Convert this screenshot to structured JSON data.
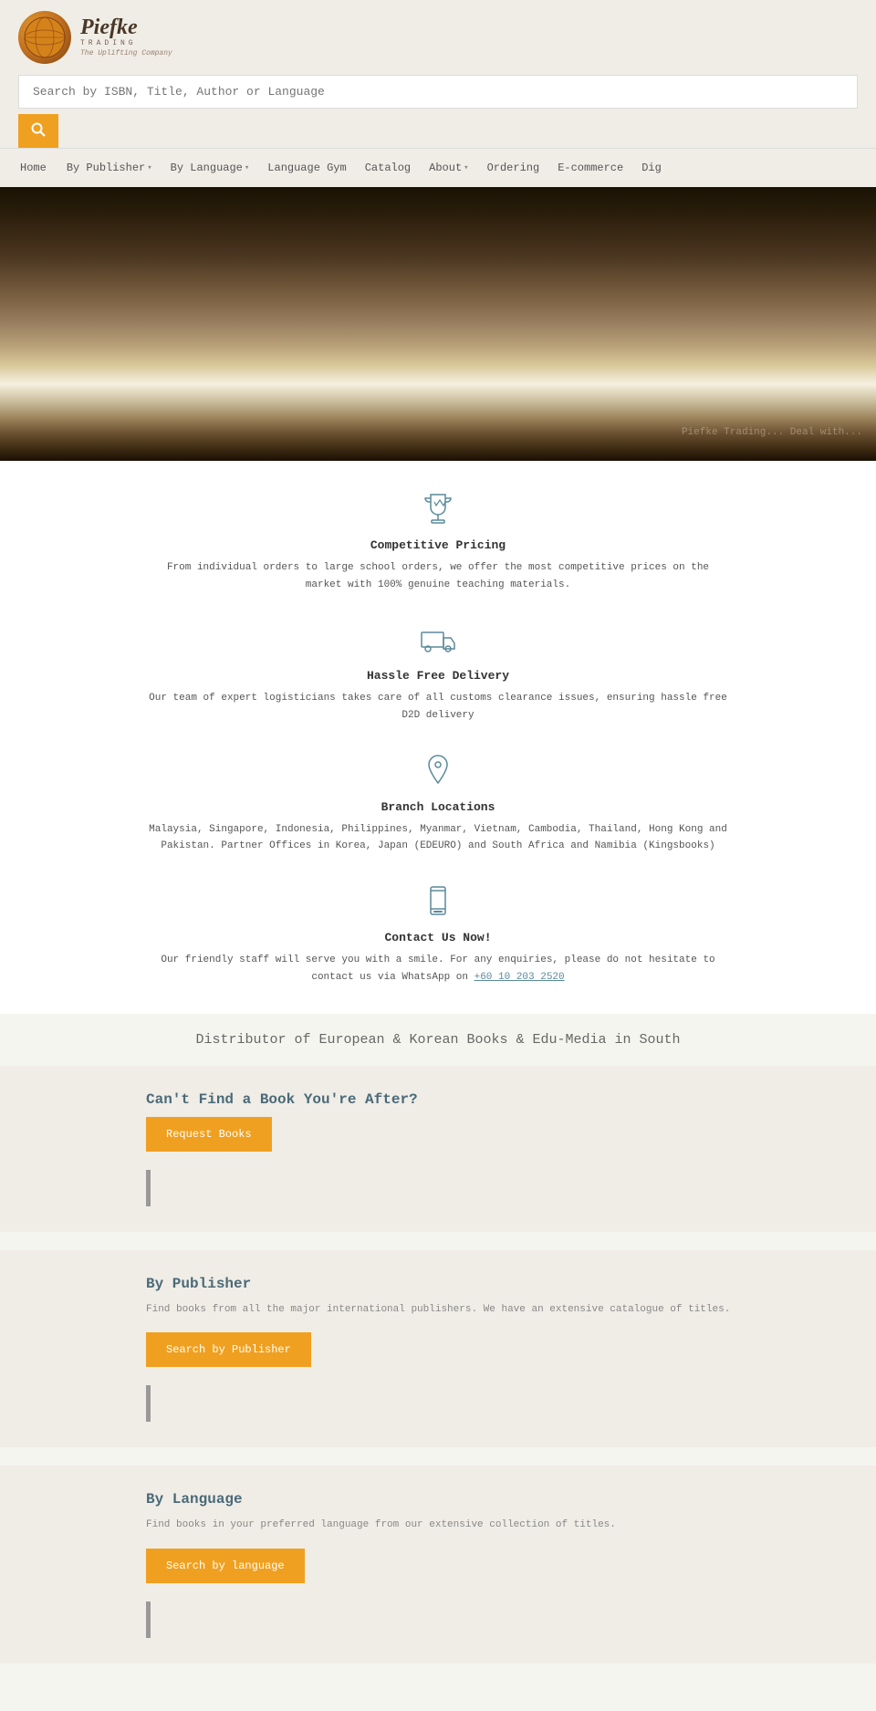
{
  "header": {
    "logo_emoji": "🌐",
    "logo_name": "Piefke",
    "logo_trading": "TRADING",
    "logo_tagline": "The Uplifting Company"
  },
  "search": {
    "placeholder": "Search by ISBN, Title, Author or Language",
    "button_label": "🔍"
  },
  "nav": {
    "items": [
      {
        "label": "Home",
        "has_dropdown": false
      },
      {
        "label": "By Publisher",
        "has_dropdown": true
      },
      {
        "label": "By Language",
        "has_dropdown": true
      },
      {
        "label": "Language Gym",
        "has_dropdown": false
      },
      {
        "label": "Catalog",
        "has_dropdown": false
      },
      {
        "label": "About",
        "has_dropdown": true
      },
      {
        "label": "Ordering",
        "has_dropdown": false
      },
      {
        "label": "E-commerce",
        "has_dropdown": false
      },
      {
        "label": "Dig",
        "has_dropdown": false
      }
    ]
  },
  "hero": {
    "watermark": "Piefke Trading... Deal with..."
  },
  "features": [
    {
      "id": "competitive-pricing",
      "icon": "trophy",
      "title": "Competitive Pricing",
      "desc": "From individual orders to large school orders, we offer the most competitive prices on the market with 100% genuine teaching materials."
    },
    {
      "id": "hassle-free-delivery",
      "icon": "truck",
      "title": "Hassle Free Delivery",
      "desc": "Our team of expert logisticians takes care of all customs clearance issues, ensuring hassle free D2D delivery"
    },
    {
      "id": "branch-locations",
      "icon": "location",
      "title": "Branch Locations",
      "desc": "Malaysia, Singapore, Indonesia, Philippines, Myanmar, Vietnam, Cambodia, Thailand,   Hong Kong and Pakistan. Partner Offices in Korea, Japan (EDEURO) and South Africa and Namibia (Kingsbooks)"
    },
    {
      "id": "contact-us",
      "icon": "phone",
      "title": "Contact Us Now!",
      "desc": "Our friendly staff will serve you with a smile.  For any enquiries, please do not hesitate to contact us via WhatsApp on",
      "link_text": "+60 10 203 2520",
      "link_href": "tel:+60102032520"
    }
  ],
  "distributor": {
    "text": "Distributor of European & Korean Books & Edu-Media in South"
  },
  "cta_sections": [
    {
      "id": "cant-find",
      "title": "Can't Find a Book You're After?",
      "desc": "",
      "button_label": "Request Books"
    },
    {
      "id": "by-publisher",
      "title": "By Publisher",
      "desc": "Find books from all the major international publishers. We have an extensive catalogue of titles.",
      "button_label": "Search by Publisher"
    },
    {
      "id": "by-language",
      "title": "By Language",
      "desc": "Find books in your preferred language from our extensive collection of titles.",
      "button_label": "Search by language"
    }
  ]
}
